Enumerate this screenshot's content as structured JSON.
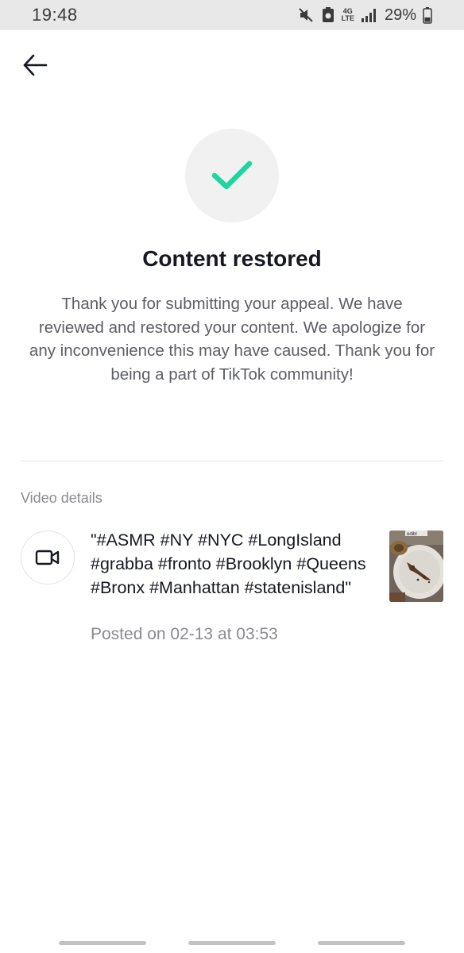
{
  "status_bar": {
    "time": "19:48",
    "battery_percent": "29%",
    "icons": [
      "mute-icon",
      "notification-icon",
      "4g-lte-icon",
      "signal-icon",
      "battery-icon"
    ],
    "network_label_top": "4G",
    "network_label_bottom": "LTE"
  },
  "header": {
    "back_icon": "arrow-left-icon"
  },
  "result": {
    "icon": "checkmark-icon",
    "icon_color": "#20d5a0",
    "title": "Content restored",
    "message": "Thank you for submitting your appeal. We have reviewed and restored your content. We apologize for any inconvenience this may have caused. Thank you for being a part of TikTok community!"
  },
  "video_details": {
    "section_label": "Video details",
    "icon": "video-camera-icon",
    "caption": "\"#ASMR #NY #NYC #LongIsland #grabba #fronto #Brooklyn #Queens #Bronx #Manhattan #statenisland\"",
    "posted": "Posted on 02-13 at 03:53",
    "thumbnail_text": "edibl"
  }
}
